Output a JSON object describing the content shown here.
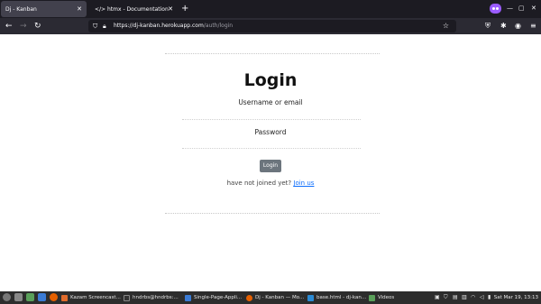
{
  "browser": {
    "tabs": [
      {
        "label": "Dj - Kanban",
        "active": true
      },
      {
        "label": "</> htmx - Documentation",
        "active": false
      }
    ],
    "new_tab_label": "+",
    "url_host": "https://dj-kanban.herokuapp.com",
    "url_path": "/auth/login",
    "icons": {
      "back": "arrow-left-icon",
      "forward": "arrow-right-icon",
      "reload": "reload-icon",
      "shield": "shield-icon",
      "lock": "lock-icon",
      "bookmark": "star-icon",
      "pocket": "pocket-icon",
      "extensions": "puzzle-icon",
      "menu": "menu-icon"
    },
    "accent_color": "#9b5cff"
  },
  "page": {
    "title": "Login",
    "username_label": "Username or email",
    "password_label": "Password",
    "login_button": "Login",
    "join_prompt": "have not joined yet?",
    "join_link": "Join us",
    "button_color": "#6c757d",
    "link_color": "#0d6efd"
  },
  "taskbar": {
    "items": [
      {
        "label": "Kazam Screencast...",
        "icon_color": "#e06b2b"
      },
      {
        "label": "hndrbs@hndrbs:...",
        "icon_color": "#333333"
      },
      {
        "label": "Single-Page-Appli...",
        "icon_color": "#3a7bd5"
      },
      {
        "label": "Dj - Kanban — Mo...",
        "icon_color": "#e66000"
      },
      {
        "label": "base.html - dj-kan...",
        "icon_color": "#2a8ad4"
      },
      {
        "label": "Videos",
        "icon_color": "#5aa05a"
      }
    ],
    "clock": "Sat Mar 19, 13:13"
  }
}
